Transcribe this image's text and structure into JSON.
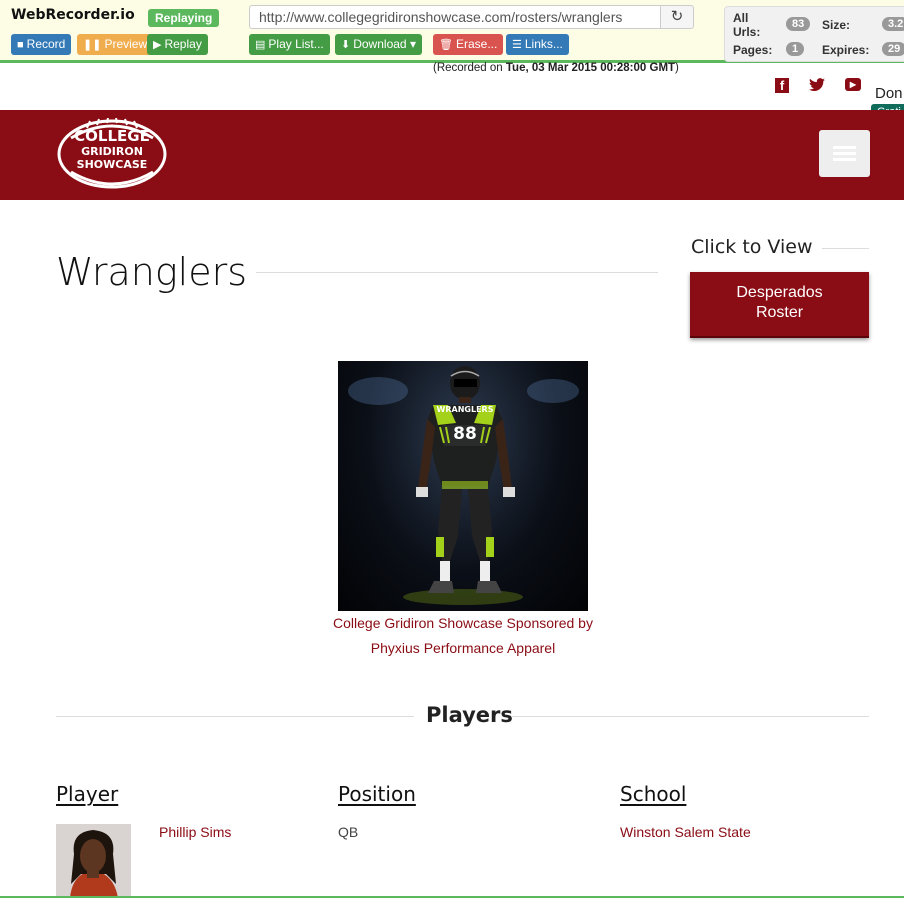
{
  "recorder": {
    "logo": "WebRecorder.io",
    "status": "Replaying",
    "buttons": {
      "record": "Record",
      "preview": "Preview",
      "replay": "Replay",
      "playlist": "Play List...",
      "download": "Download",
      "erase": "Erase...",
      "links": "Links..."
    },
    "url": "http://www.collegegridironshowcase.com/rosters/wranglers",
    "stats": {
      "all_urls_label": "All Urls:",
      "all_urls_value": "83",
      "size_label": "Size:",
      "size_value": "3.2",
      "pages_label": "Pages:",
      "pages_value": "1",
      "expires_label": "Expires:",
      "expires_value": "29"
    },
    "recorded_prefix": "(Recorded on ",
    "recorded_date": "Tue, 03 Mar 2015 00:28:00 GMT",
    "recorded_suffix": ")"
  },
  "social": {
    "facebook": "f",
    "twitter": "t",
    "youtube": "▶",
    "donate": "Don",
    "grat": "Grati"
  },
  "site": {
    "logo_line1": "COLLEGE",
    "logo_line2": "GRIDIRON",
    "logo_line3": "SHOWCASE",
    "colors": {
      "brand": "#8a0c14",
      "accent_green": "#5cb85c"
    }
  },
  "page": {
    "title": "Wranglers",
    "click_to_view": "Click to View",
    "roster_button_line1": "Desperados",
    "roster_button_line2": "Roster",
    "jersey_text": "WRANGLERS",
    "jersey_number": "88",
    "caption_line1": "College Gridiron Showcase Sponsored by",
    "caption_line2": "Phyxius Performance Apparel",
    "players_heading": "Players"
  },
  "table": {
    "headers": [
      "Player",
      "Position",
      "School"
    ],
    "rows": [
      {
        "name": "Phillip Sims",
        "position": "QB",
        "school": "Winston Salem State"
      }
    ]
  }
}
